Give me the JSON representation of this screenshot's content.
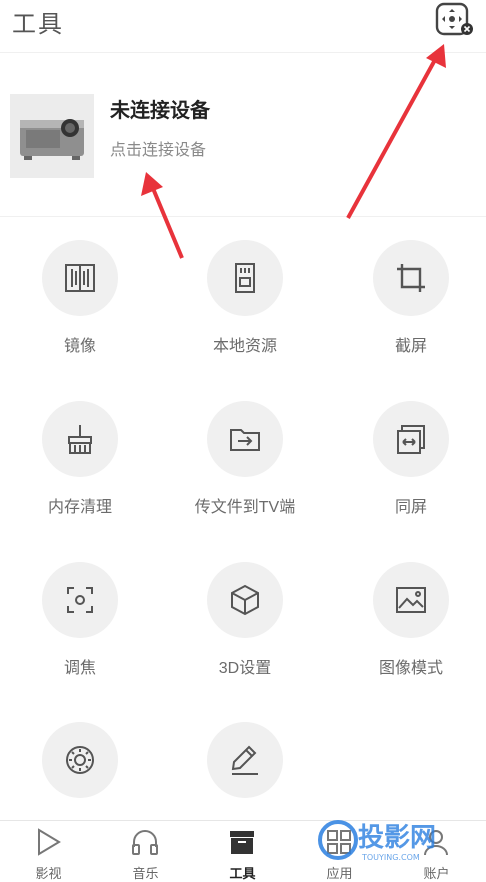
{
  "header": {
    "title": "工具"
  },
  "device": {
    "status": "未连接设备",
    "action": "点击连接设备"
  },
  "tools": [
    {
      "label": "镜像",
      "icon": "mirror-icon"
    },
    {
      "label": "本地资源",
      "icon": "sd-card-icon"
    },
    {
      "label": "截屏",
      "icon": "crop-icon"
    },
    {
      "label": "内存清理",
      "icon": "broom-icon"
    },
    {
      "label": "传文件到TV端",
      "icon": "folder-transfer-icon"
    },
    {
      "label": "同屏",
      "icon": "screen-mirror-icon"
    },
    {
      "label": "调焦",
      "icon": "focus-icon"
    },
    {
      "label": "3D设置",
      "icon": "cube-icon"
    },
    {
      "label": "图像模式",
      "icon": "image-icon"
    },
    {
      "label": "",
      "icon": "speaker-icon"
    },
    {
      "label": "",
      "icon": "pen-icon"
    }
  ],
  "tabbar": [
    {
      "label": "影视",
      "icon": "play-icon",
      "active": false
    },
    {
      "label": "音乐",
      "icon": "headphones-icon",
      "active": false
    },
    {
      "label": "工具",
      "icon": "toolbox-icon",
      "active": true
    },
    {
      "label": "应用",
      "icon": "apps-icon",
      "active": false
    },
    {
      "label": "账户",
      "icon": "account-icon",
      "active": false
    }
  ],
  "watermark": {
    "text": "投影网",
    "subtext": "TOUYING.COM"
  },
  "colors": {
    "accent_arrow": "#e8333b",
    "icon_gray": "#555555",
    "circle_bg": "#f0f0f0",
    "watermark_blue": "#2a7fe0"
  }
}
